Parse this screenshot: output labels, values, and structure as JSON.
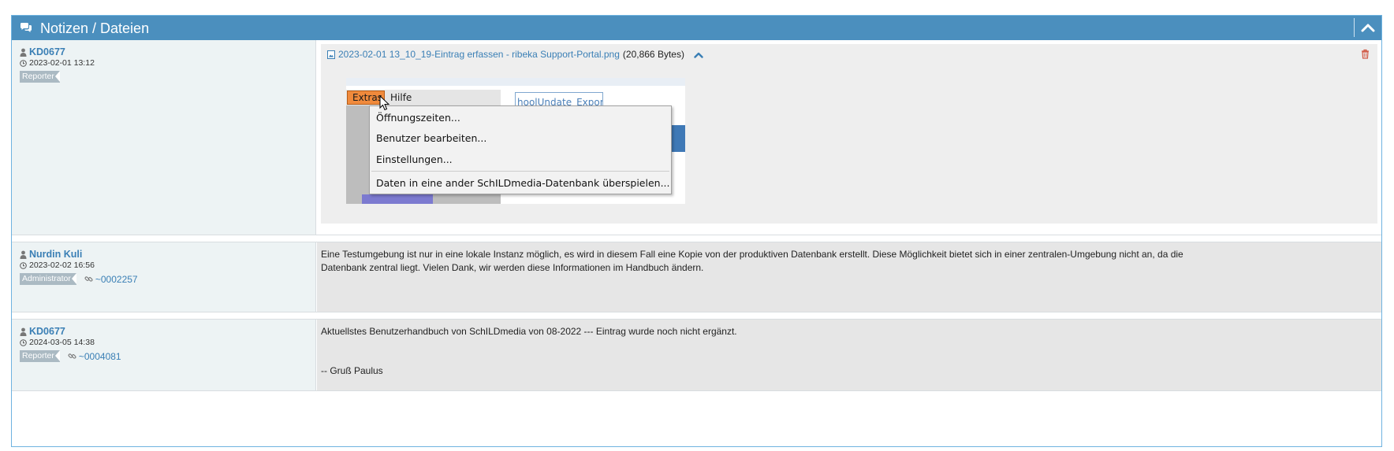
{
  "header": {
    "title": "Notizen / Dateien",
    "title_icon": "comments-icon",
    "collapse_icon": "chevron-up-icon"
  },
  "notes": [
    {
      "user": "KD0677",
      "date": "2023-02-01 13:12",
      "role": "Reporter",
      "attachment": {
        "filename": "2023-02-01 13_10_19-Eintrag erfassen - ribeka Support-Portal.png",
        "size": "(20,866 Bytes)",
        "screenshot": {
          "menu_extras": "Extras",
          "menu_hilfe": "Hilfe",
          "background_text": "hoolUndate_Export",
          "menu_items": [
            "Öffnungszeiten...",
            "Benutzer bearbeiten...",
            "Einstellungen...",
            "Daten in eine ander SchILDmedia-Datenbank überspielen..."
          ]
        }
      }
    },
    {
      "user": "Nurdin Kuli",
      "date": "2023-02-02 16:56",
      "role": "Administrator",
      "note_id": "~0002257",
      "text": [
        "Eine Testumgebung ist nur in eine lokale Instanz möglich, es wird in diesem Fall eine Kopie von der produktiven Datenbank erstellt. Diese Möglichkeit bietet sich in einer zentralen-Umgebung nicht an, da die",
        "Datenbank zentral liegt. Vielen Dank, wir werden diese Informationen im Handbuch ändern."
      ]
    },
    {
      "user": "KD0677",
      "date": "2024-03-05 14:38",
      "role": "Reporter",
      "note_id": "~0004081",
      "text": [
        "Aktuellstes Benutzerhandbuch von SchILDmedia von 08-2022 --- Eintrag wurde noch nicht ergänzt.",
        "-- Gruß Paulus"
      ]
    }
  ],
  "colors": {
    "header_bg": "#4b8fbe",
    "link": "#3a7fb5",
    "badge": "#abbac3",
    "delete": "#d15b47"
  }
}
